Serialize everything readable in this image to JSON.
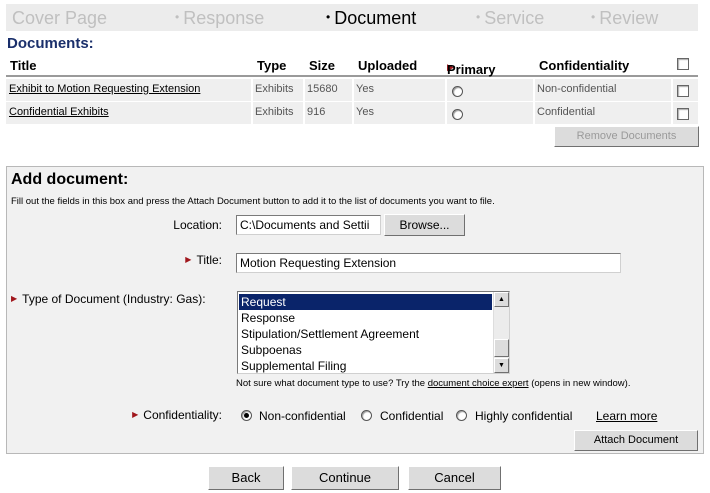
{
  "steps": [
    {
      "label": "Cover Page",
      "active": false
    },
    {
      "label": "Response",
      "active": false
    },
    {
      "label": "Document",
      "active": true
    },
    {
      "label": "Service",
      "active": false
    },
    {
      "label": "Review",
      "active": false
    }
  ],
  "documents": {
    "heading": "Documents:",
    "columns": {
      "title": "Title",
      "type": "Type",
      "size": "Size",
      "uploaded": "Uploaded",
      "primary": "Primary",
      "confidentiality": "Confidentiality"
    },
    "rows": [
      {
        "title": "Exhibit to Motion Requesting Extension",
        "type": "Exhibits",
        "size": "15680",
        "uploaded": "Yes",
        "confidentiality": "Non-confidential"
      },
      {
        "title": "Confidential Exhibits",
        "type": "Exhibits",
        "size": "916",
        "uploaded": "Yes",
        "confidentiality": "Confidential"
      }
    ],
    "remove_button": "Remove Documents"
  },
  "add_document": {
    "title": "Add document:",
    "instructions": "Fill out the fields in this box and press the Attach Document button to add it to the list of documents you want to file.",
    "location_label": "Location:",
    "location_value": "C:\\Documents and Settii",
    "browse_button": "Browse...",
    "title_label": "Title:",
    "title_value": "Motion Requesting Extension",
    "type_label": "Type of Document (Industry: Gas):",
    "type_options": [
      "Request",
      "Response",
      "Stipulation/Settlement Agreement",
      "Subpoenas",
      "Supplemental Filing"
    ],
    "type_selected": "Request",
    "hint_prefix": "Not sure what document type to use? Try the",
    "hint_link": "document choice expert",
    "hint_suffix": "(opens in new window).",
    "confidentiality_label": "Confidentiality:",
    "confidentiality_options": [
      "Non-confidential",
      "Confidential",
      "Highly confidential"
    ],
    "confidentiality_selected": "Non-confidential",
    "learn_more": "Learn more",
    "attach_button": "Attach Document"
  },
  "footer": {
    "back": "Back",
    "continue": "Continue",
    "cancel": "Cancel"
  },
  "colors": {
    "heading": "#1a2f6b",
    "required_marker": "#a0161c",
    "selected_option": "#0a246a"
  },
  "icons": {
    "required_marker": "red-triangle-icon",
    "scroll_up": "scroll-up-arrow-icon",
    "scroll_down": "scroll-down-arrow-icon"
  }
}
